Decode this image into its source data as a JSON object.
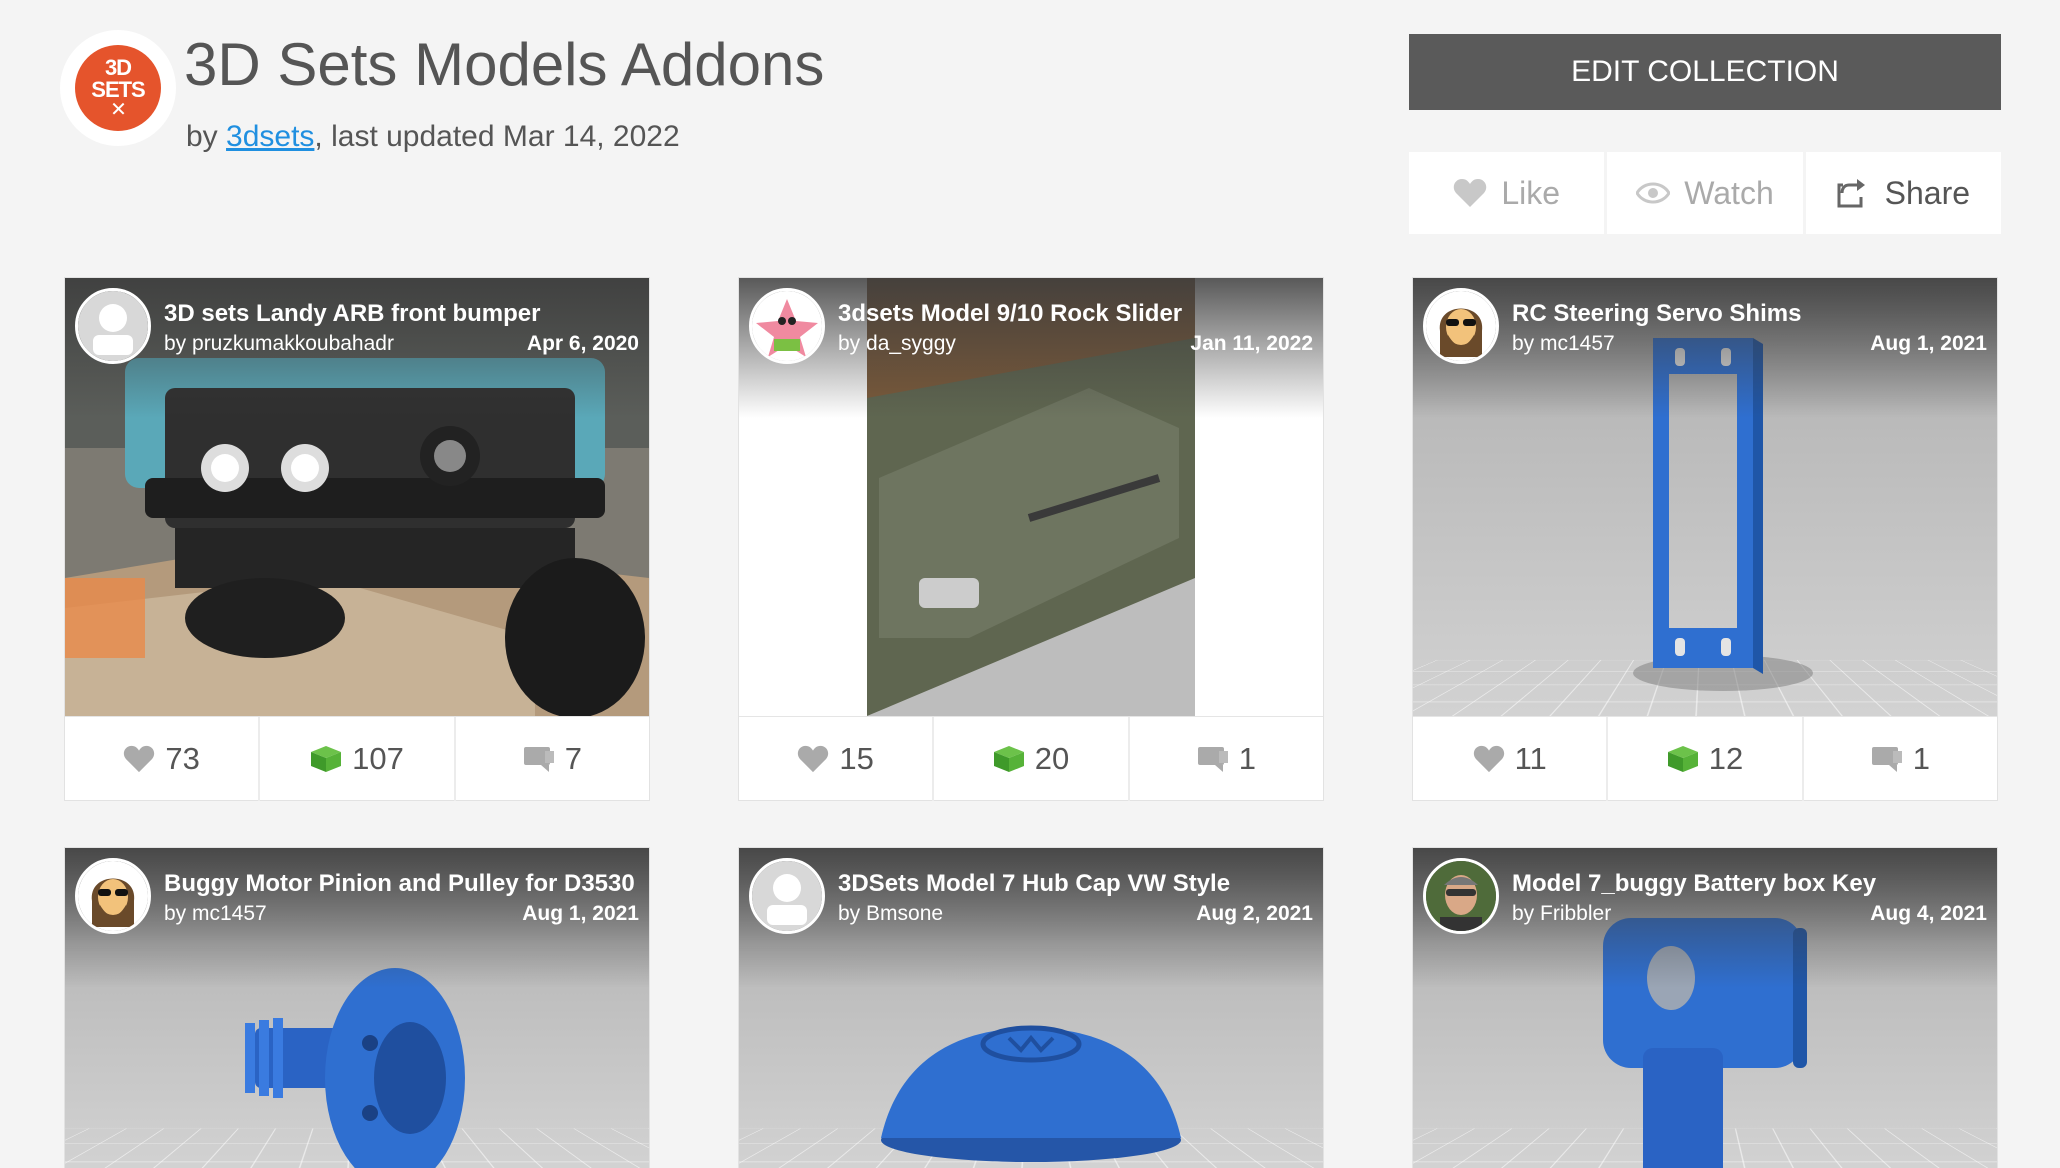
{
  "header": {
    "title": "3D Sets Models Addons",
    "by_prefix": "by ",
    "author": "3dsets",
    "updated": ", last updated Mar 14, 2022",
    "logo_text_1": "3D",
    "logo_text_2": "SETS",
    "logo_text_3": "✕"
  },
  "actions": {
    "edit_collection": "EDIT COLLECTION",
    "like": "Like",
    "watch": "Watch",
    "share": "Share"
  },
  "cards": [
    {
      "title": "3D sets Landy ARB front bumper",
      "author": "by pruzkumakkoubahadr",
      "date": "Apr 6, 2020",
      "likes": "73",
      "makes": "107",
      "comments": "7"
    },
    {
      "title": "3dsets Model 9/10 Rock Slider",
      "author": "by da_syggy",
      "date": "Jan 11, 2022",
      "likes": "15",
      "makes": "20",
      "comments": "1"
    },
    {
      "title": "RC Steering Servo Shims",
      "author": "by mc1457",
      "date": "Aug 1, 2021",
      "likes": "11",
      "makes": "12",
      "comments": "1"
    },
    {
      "title": "Buggy Motor Pinion and Pulley for D3530",
      "author": "by mc1457",
      "date": "Aug 1, 2021"
    },
    {
      "title": "3DSets Model 7 Hub Cap VW Style",
      "author": "by Bmsone",
      "date": "Aug 2, 2021"
    },
    {
      "title": "Model 7_buggy Battery box Key",
      "author": "by Fribbler",
      "date": "Aug 4, 2021"
    }
  ],
  "colors": {
    "accent_link": "#1f8fe0",
    "edit_button": "#5a5a5a",
    "logo": "#e5542c",
    "make_icon": "#4caf34",
    "model_blue": "#2f6fd0"
  },
  "icons": {
    "like": "heart-icon",
    "watch": "eye-icon",
    "share": "share-icon",
    "makes": "cube-icon",
    "comments": "comment-icon"
  }
}
